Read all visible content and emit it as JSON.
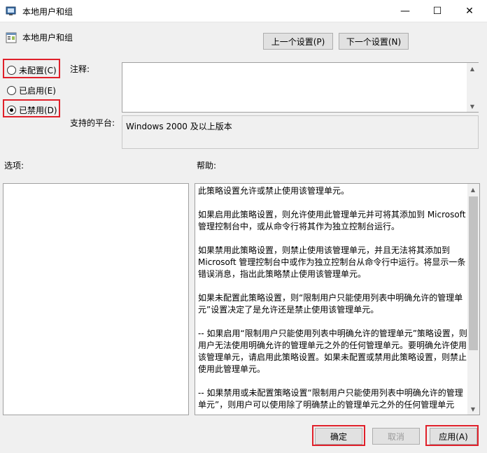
{
  "window": {
    "title": "本地用户和组",
    "minimize": "—",
    "maximize": "☐",
    "close": "✕"
  },
  "header": {
    "policy_name": "本地用户和组",
    "prev_button": "上一个设置(P)",
    "next_button": "下一个设置(N)"
  },
  "state": {
    "options": [
      {
        "label": "未配置(C)",
        "checked": false
      },
      {
        "label": "已启用(E)",
        "checked": false
      },
      {
        "label": "已禁用(D)",
        "checked": true
      }
    ]
  },
  "comment": {
    "label": "注释:",
    "value": ""
  },
  "platform": {
    "label": "支持的平台:",
    "value": "Windows 2000 及以上版本"
  },
  "options_panel": {
    "label": "选项:"
  },
  "help_panel": {
    "label": "帮助:",
    "paragraphs": [
      "此策略设置允许或禁止使用该管理单元。",
      "如果启用此策略设置，则允许使用此管理单元并可将其添加到 Microsoft 管理控制台中，或从命令行将其作为独立控制台运行。",
      "如果禁用此策略设置，则禁止使用该管理单元，并且无法将其添加到 Microsoft 管理控制台中或作为独立控制台从命令行中运行。将显示一条错误消息，指出此策略禁止使用该管理单元。",
      "如果未配置此策略设置，则“限制用户只能使用列表中明确允许的管理单元”设置决定了是允许还是禁止使用该管理单元。",
      "-- 如果启用“限制用户只能使用列表中明确允许的管理单元”策略设置，则用户无法使用明确允许的管理单元之外的任何管理单元。要明确允许使用该管理单元，请启用此策略设置。如果未配置或禁用此策略设置，则禁止使用此管理单元。",
      "-- 如果禁用或未配置策略设置“限制用户只能使用列表中明确允许的管理单元”，则用户可以使用除了明确禁止的管理单元之外的任何管理单元"
    ]
  },
  "footer": {
    "ok": "确定",
    "cancel": "取消",
    "apply": "应用(A)"
  }
}
